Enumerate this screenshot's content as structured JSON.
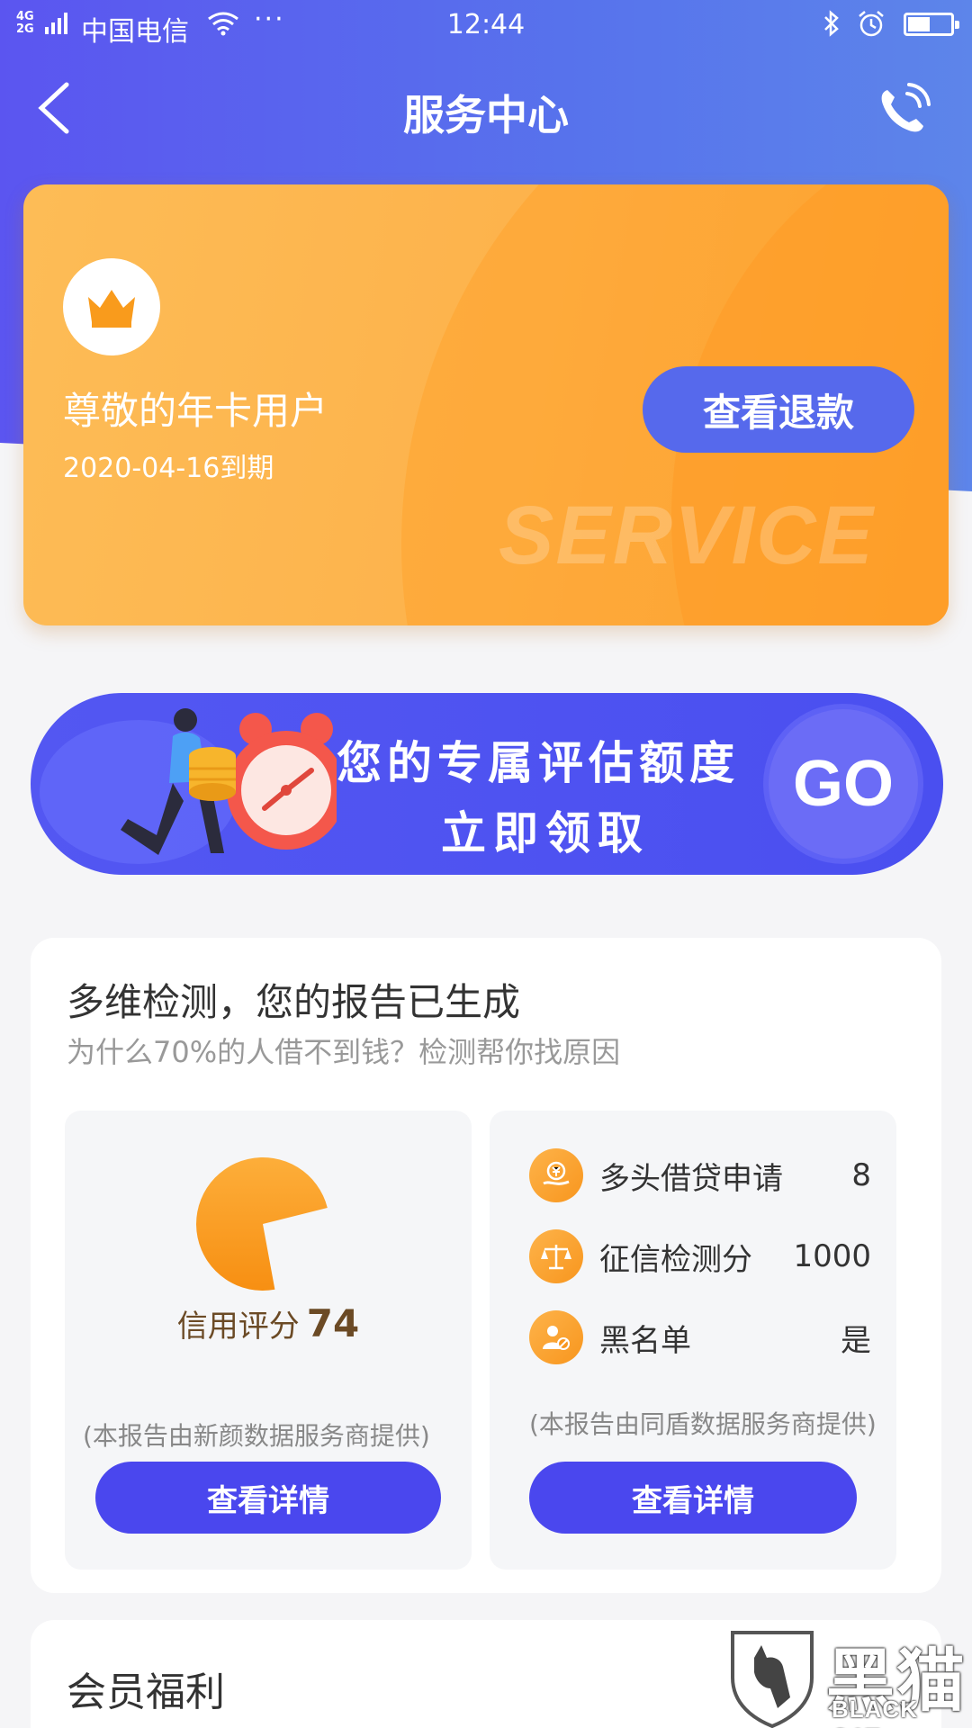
{
  "status_bar": {
    "network": "4G\n2G",
    "carrier": "中国电信",
    "more": "···",
    "time": "12:44"
  },
  "header": {
    "title": "服务中心"
  },
  "membership": {
    "label": "尊敬的年卡用户",
    "expiry": "2020-04-16到期",
    "refund_button": "查看退款",
    "watermark": "SERVICE"
  },
  "promo": {
    "line1": "您的专属评估额度",
    "line2": "立即领取",
    "go": "GO"
  },
  "report": {
    "title": "多维检测，您的报告已生成",
    "subtitle": "为什么70%的人借不到钱？检测帮你找原因",
    "credit": {
      "label": "信用评分",
      "score": "74",
      "score_fraction": 0.74,
      "provider": "(本报告由新颜数据服务商提供)",
      "button": "查看详情"
    },
    "stats": [
      {
        "icon": "yen-hand-icon",
        "label": "多头借贷申请",
        "value": "8"
      },
      {
        "icon": "scale-icon",
        "label": "征信检测分",
        "value": "1000"
      },
      {
        "icon": "blacklist-user-icon",
        "label": "黑名单",
        "value": "是"
      }
    ],
    "provider_right": "(本报告由同盾数据服务商提供)",
    "button_right": "查看详情"
  },
  "benefits": {
    "title": "会员福利"
  },
  "watermark": {
    "cn": "黑猫",
    "en": "BLACK CAT"
  },
  "colors": {
    "header_blue": "#5b62ef",
    "card_orange": "#fdb24b",
    "button_blue": "#4a47ee",
    "refund_blue": "#5669ec",
    "score_brown": "#6b4a25"
  }
}
